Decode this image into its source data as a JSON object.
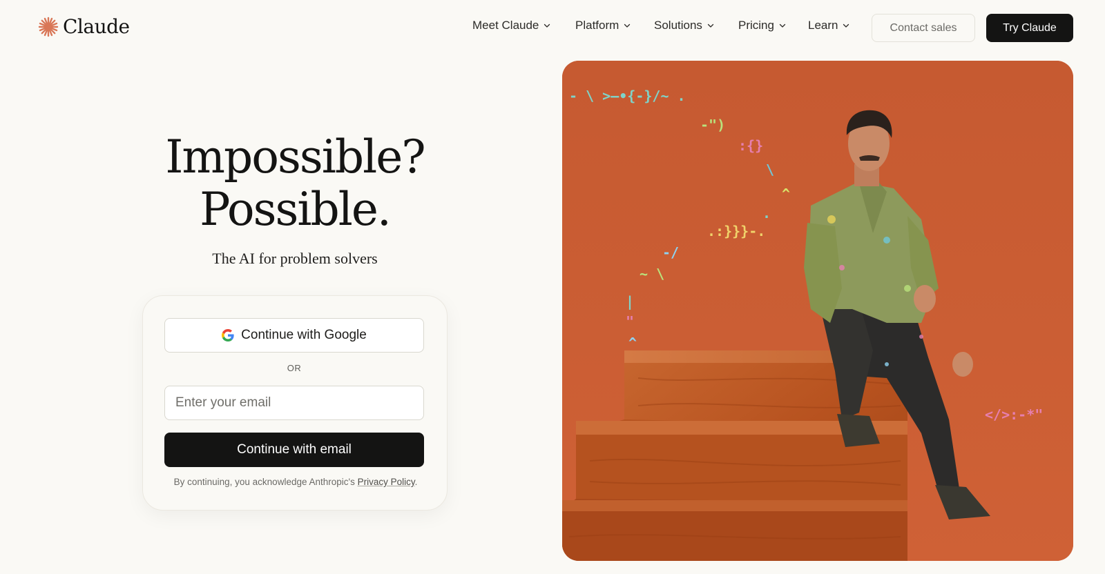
{
  "header": {
    "brand": "Claude",
    "nav": [
      {
        "label": "Meet Claude"
      },
      {
        "label": "Platform"
      },
      {
        "label": "Solutions"
      },
      {
        "label": "Pricing"
      },
      {
        "label": "Learn"
      }
    ],
    "contact_label": "Contact sales",
    "try_label": "Try Claude"
  },
  "hero": {
    "title_line1": "Impossible?",
    "title_line2": "Possible.",
    "subtitle": "The AI for problem solvers"
  },
  "signin": {
    "google_label": "Continue with Google",
    "or_label": "OR",
    "email_placeholder": "Enter your email",
    "email_value": "",
    "email_button": "Continue with email",
    "legal_prefix": "By continuing, you acknowledge Anthropic's",
    "legal_link": "Privacy Policy",
    "legal_suffix": "."
  },
  "icons": {
    "logo": "claude-starburst-icon",
    "dropdown": "chevron-down-icon",
    "google": "google-g-icon"
  },
  "colors": {
    "background": "#faf9f5",
    "text": "#141413",
    "brand_accent": "#d97757",
    "primary_button": "#141413",
    "hero_background": "#c8582f"
  }
}
